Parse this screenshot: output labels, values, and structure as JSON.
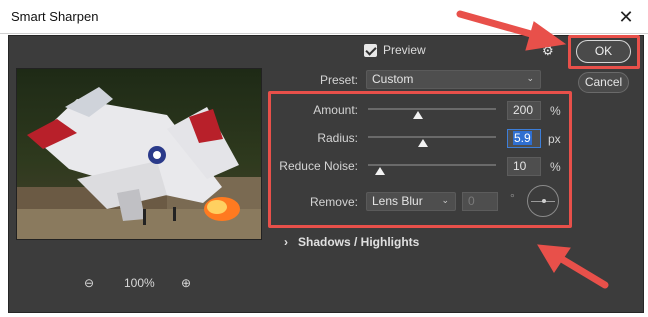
{
  "window": {
    "title": "Smart Sharpen",
    "close_glyph": "✕"
  },
  "dialog": {
    "preview_label": "Preview",
    "preset_label": "Preset:",
    "preset_value": "Custom",
    "ok_label": "OK",
    "cancel_label": "Cancel",
    "settings": {
      "amount": {
        "label": "Amount:",
        "value": "200",
        "unit": "%",
        "slider_fraction": 0.39
      },
      "radius": {
        "label": "Radius:",
        "value": "5.9",
        "unit": "px",
        "slider_fraction": 0.43
      },
      "noise": {
        "label": "Reduce Noise:",
        "value": "10",
        "unit": "%",
        "slider_fraction": 0.1
      }
    },
    "remove_label": "Remove:",
    "remove_value": "Lens Blur",
    "angle_value": "0",
    "angle_unit": "°",
    "shadows_label": "Shadows / Highlights",
    "shadows_chevron": "›",
    "zoom_out_icon": "⊖",
    "zoom_in_icon": "⊕",
    "zoom_level": "100%"
  },
  "annotation_color": "#e8504a"
}
